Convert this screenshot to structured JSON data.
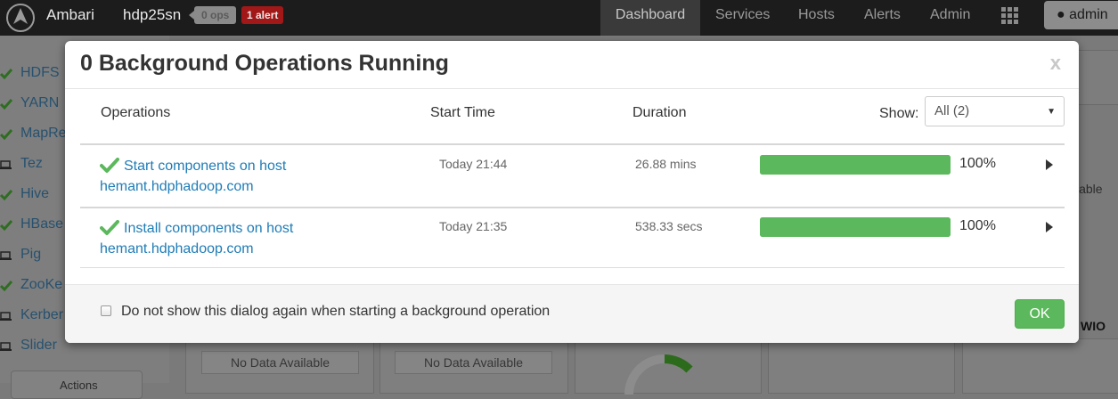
{
  "navbar": {
    "brand": "Ambari",
    "cluster": "hdp25sn",
    "ops_badge": "0 ops",
    "alert_badge": "1 alert",
    "tabs": [
      {
        "label": "Dashboard",
        "active": true
      },
      {
        "label": "Services"
      },
      {
        "label": "Hosts"
      },
      {
        "label": "Alerts"
      },
      {
        "label": "Admin"
      }
    ],
    "user": "admin"
  },
  "sidebar": {
    "services": [
      {
        "label": "HDFS",
        "icon": "check-icon"
      },
      {
        "label": "YARN",
        "icon": "check-icon"
      },
      {
        "label": "MapRe",
        "icon": "check-icon"
      },
      {
        "label": "Tez",
        "icon": "laptop-icon"
      },
      {
        "label": "Hive",
        "icon": "check-icon"
      },
      {
        "label": "HBase",
        "icon": "check-icon"
      },
      {
        "label": "Pig",
        "icon": "laptop-icon"
      },
      {
        "label": "ZooKe",
        "icon": "check-icon"
      },
      {
        "label": "Kerber",
        "icon": "laptop-icon"
      },
      {
        "label": "Slider",
        "icon": "laptop-icon"
      }
    ],
    "actions_label": "Actions"
  },
  "background": {
    "no_data": "No Data Available",
    "edge_label": "lable",
    "wio": "WIO"
  },
  "modal": {
    "title": "0 Background Operations Running",
    "close": "x",
    "headers": {
      "operations": "Operations",
      "start_time": "Start Time",
      "duration": "Duration"
    },
    "show_label": "Show:",
    "show_value": "All (2)",
    "operations": [
      {
        "name": "Start components on host hemant.hdphadoop.com",
        "start_time": "Today 21:44",
        "duration": "26.88 mins",
        "progress": 100,
        "progress_label": "100%"
      },
      {
        "name": "Install components on host hemant.hdphadoop.com",
        "start_time": "Today 21:35",
        "duration": "538.33 secs",
        "progress": 100,
        "progress_label": "100%"
      }
    ],
    "footer_checkbox_label": "Do not show this dialog again when starting a background operation",
    "ok_label": "OK"
  },
  "colors": {
    "success": "#5cb85c",
    "link": "#1f7cb6",
    "alert": "#a21818"
  }
}
